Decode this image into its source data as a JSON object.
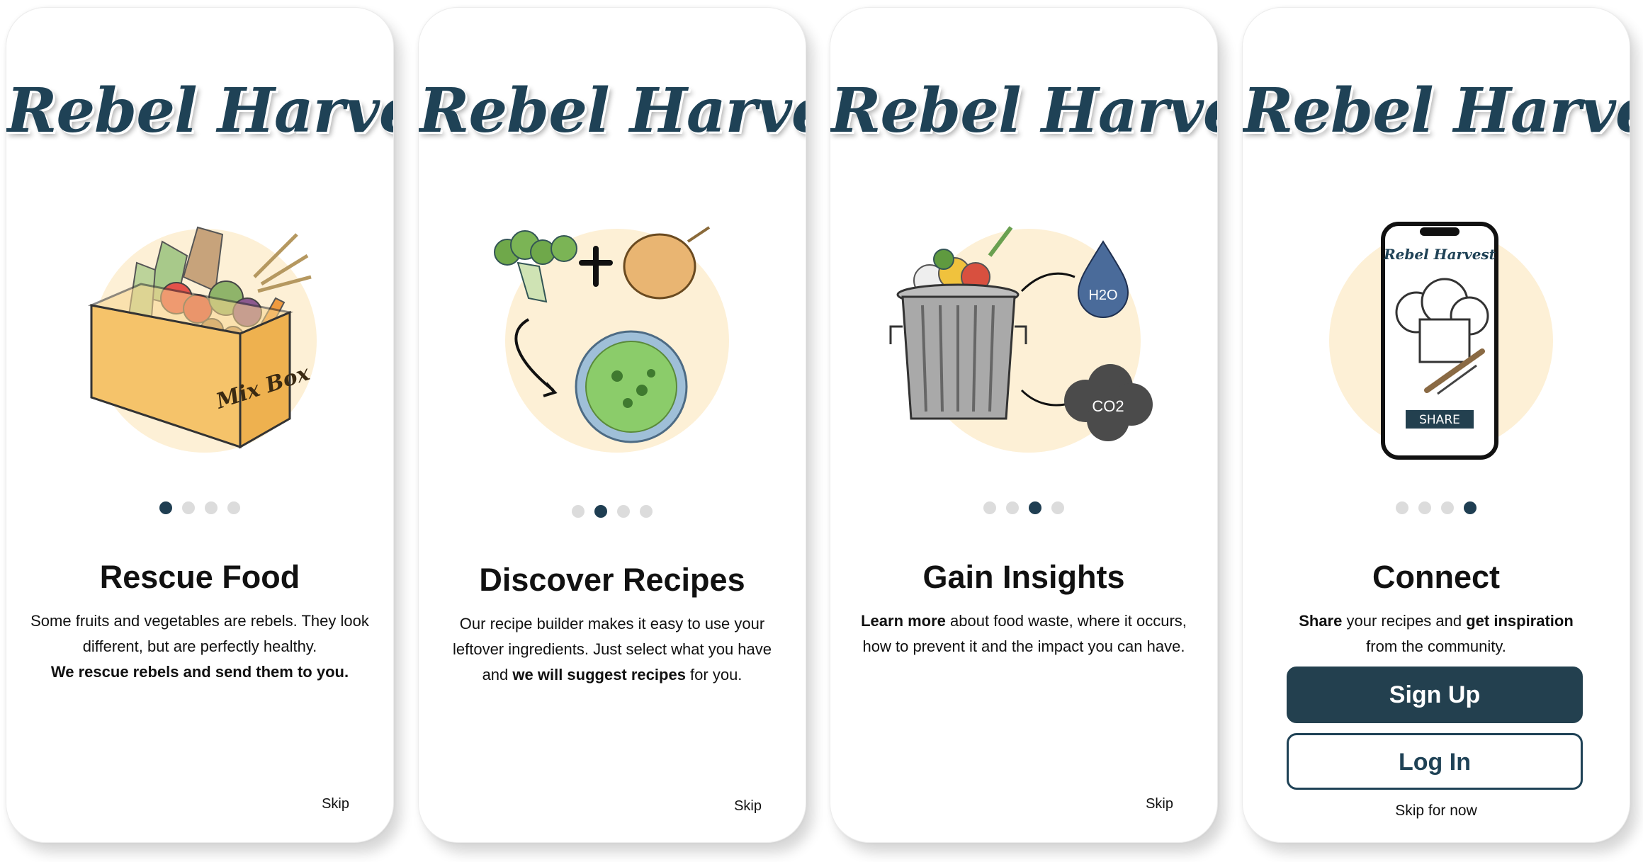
{
  "app": {
    "logo_text": "Rebel Harvest"
  },
  "colors": {
    "brand": "#1f4256",
    "dot_inactive": "#dcdcdc",
    "halo": "#fdf0d6"
  },
  "screens": [
    {
      "title": "Rescue Food",
      "pagination": {
        "current": 1,
        "total": 4
      },
      "illustration": {
        "name": "mix-box-illustration",
        "box_label": "Mix Box"
      },
      "body": {
        "line1": "Some fruits and vegetables are rebels. They look",
        "line2": "different, but are perfectly healthy.",
        "line3": "We rescue rebels and send them to you."
      },
      "skip_label": "Skip"
    },
    {
      "title": "Discover Recipes",
      "pagination": {
        "current": 2,
        "total": 4
      },
      "illustration": {
        "name": "recipe-builder-illustration"
      },
      "body": {
        "line1": "Our recipe builder makes it easy to use your",
        "line2": "leftover ingredients. Just select what you have",
        "line3_pre": "and ",
        "line3_bold": "we will suggest recipes",
        "line3_post": " for you."
      },
      "skip_label": "Skip"
    },
    {
      "title": "Gain Insights",
      "pagination": {
        "current": 3,
        "total": 4
      },
      "illustration": {
        "name": "food-waste-illustration",
        "water_label": "H2O",
        "gas_label": "CO2"
      },
      "body": {
        "line1_bold": "Learn more",
        "line1_post": " about food waste, where it occurs,",
        "line2": "how to prevent it and the impact you can have."
      },
      "skip_label": "Skip"
    },
    {
      "title": "Connect",
      "pagination": {
        "current": 4,
        "total": 4
      },
      "illustration": {
        "name": "phone-share-illustration",
        "phone_logo": "Rebel Harvest",
        "share_label": "SHARE"
      },
      "body": {
        "line1_bold1": "Share",
        "line1_mid": " your recipes and ",
        "line1_bold2": "get inspiration",
        "line2": "from the community."
      },
      "signup_label": "Sign Up",
      "login_label": "Log In",
      "skip_label": "Skip for now"
    }
  ]
}
